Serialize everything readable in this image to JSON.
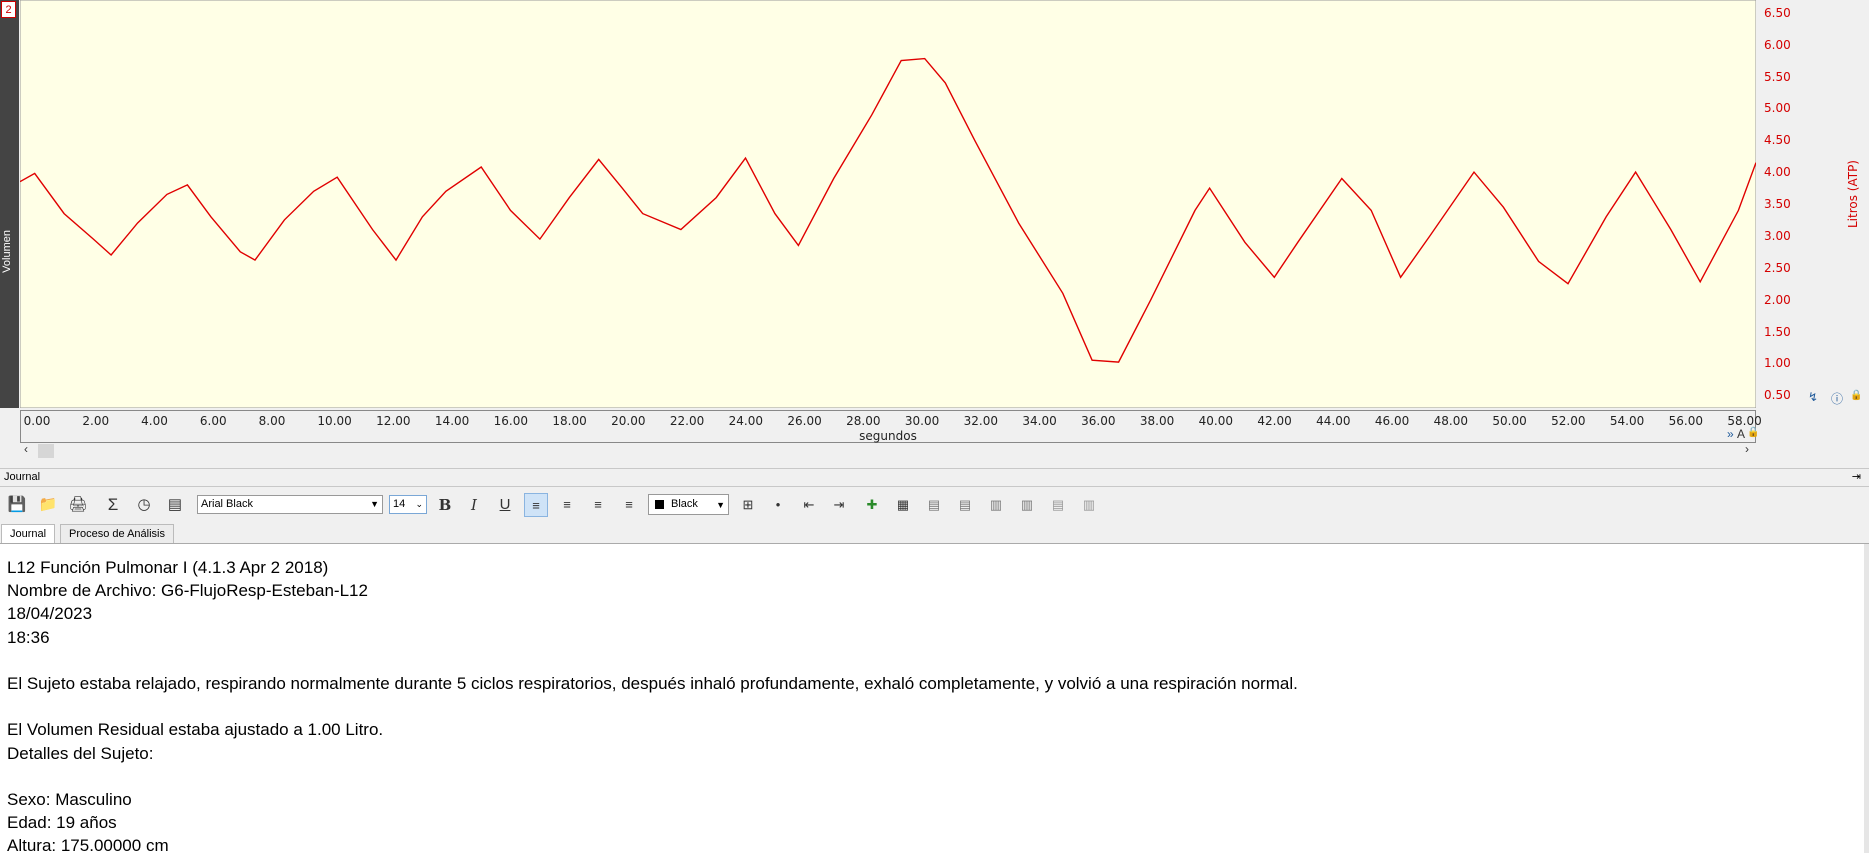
{
  "channel": {
    "number": "2",
    "label": "Volumen"
  },
  "chart_data": {
    "type": "line",
    "xlabel": "segundos",
    "ylabel": "Litros (ATP)",
    "xlim": [
      -0.5,
      58.6
    ],
    "ylim": [
      0.3,
      6.7
    ],
    "x_ticks": [
      "0.00",
      "2.00",
      "4.00",
      "6.00",
      "8.00",
      "10.00",
      "12.00",
      "14.00",
      "16.00",
      "18.00",
      "20.00",
      "22.00",
      "24.00",
      "26.00",
      "28.00",
      "30.00",
      "32.00",
      "34.00",
      "36.00",
      "38.00",
      "40.00",
      "42.00",
      "44.00",
      "46.00",
      "48.00",
      "50.00",
      "52.00",
      "54.00",
      "56.00",
      "58.00"
    ],
    "y_ticks": [
      "6.50",
      "6.00",
      "5.50",
      "5.00",
      "4.50",
      "4.00",
      "3.50",
      "3.00",
      "2.50",
      "2.00",
      "1.50",
      "1.00",
      "0.50"
    ],
    "series": [
      {
        "color": "#e00000",
        "x": [
          -0.5,
          0.0,
          1.0,
          2.0,
          2.6,
          3.5,
          4.5,
          5.2,
          6.0,
          7.0,
          7.5,
          8.5,
          9.5,
          10.3,
          11.5,
          12.3,
          13.2,
          14.0,
          15.2,
          16.2,
          17.2,
          18.2,
          19.2,
          20.0,
          20.7,
          22.0,
          23.2,
          24.2,
          25.2,
          26.0,
          27.2,
          28.5,
          29.5,
          30.3,
          31.0,
          32.0,
          33.5,
          35.0,
          36.0,
          36.9,
          38.0,
          39.5,
          40.0,
          41.2,
          42.2,
          43.0,
          44.5,
          45.5,
          46.5,
          47.5,
          49.0,
          50.0,
          51.2,
          52.2,
          53.5,
          54.5,
          55.7,
          56.7,
          58.0,
          58.6
        ],
        "y": [
          3.85,
          3.98,
          3.35,
          2.95,
          2.7,
          3.2,
          3.65,
          3.8,
          3.3,
          2.75,
          2.62,
          3.25,
          3.7,
          3.92,
          3.1,
          2.62,
          3.3,
          3.7,
          4.08,
          3.4,
          2.95,
          3.6,
          4.2,
          3.75,
          3.35,
          3.1,
          3.6,
          4.22,
          3.35,
          2.85,
          3.9,
          4.9,
          5.75,
          5.78,
          5.4,
          4.5,
          3.2,
          2.1,
          1.05,
          1.02,
          2.0,
          3.4,
          3.75,
          2.9,
          2.35,
          2.9,
          3.9,
          3.4,
          2.35,
          3.0,
          4.0,
          3.45,
          2.6,
          2.25,
          3.3,
          4.0,
          3.1,
          2.28,
          3.4,
          4.15
        ]
      }
    ]
  },
  "journal": {
    "title": "Journal",
    "font_name": "Arial Black",
    "font_size": "14",
    "color_name": "Black",
    "tabs": [
      "Journal",
      "Proceso de Análisis"
    ],
    "lines": [
      "L12 Función Pulmonar I (4.1.3 Apr  2 2018)",
      "Nombre de Archivo: G6-FlujoResp-Esteban-L12",
      "18/04/2023",
      "18:36",
      "",
      "El Sujeto estaba relajado, respirando normalmente durante 5 ciclos respiratorios, después inhaló profundamente, exhaló completamente, y volvió a una respiración normal.",
      "",
      "El Volumen Residual estaba ajustado a  1.00 Litro.",
      "Detalles del Sujeto:",
      "",
      "Sexo: Masculino",
      "Edad:  19 años",
      "Altura:  175.00000 cm"
    ]
  },
  "colors": {
    "plot_bg": "#ffffe6",
    "trace": "#e00000",
    "axis_text": "#d40000"
  }
}
